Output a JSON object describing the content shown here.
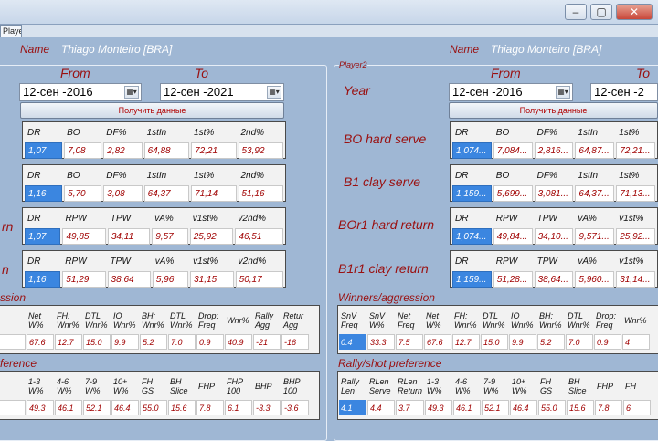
{
  "window": {
    "tab_label": "Player2",
    "controls": {
      "minimize": "–",
      "maximize": "▢",
      "close": "✕"
    }
  },
  "left": {
    "name_label": "Name",
    "name_value": "Thiago Monteiro [BRA]",
    "from_label": "From",
    "to_label": "To",
    "from_date": "12-сен -2016",
    "to_date": "12-сен -2021",
    "get_data_button": "Получить данные",
    "row_labels": [
      "",
      "",
      "rn",
      "n"
    ],
    "serve_headers": [
      "DR",
      "BO",
      "DF%",
      "1stIn",
      "1st%",
      "2nd%"
    ],
    "return_headers": [
      "DR",
      "RPW",
      "TPW",
      "vA%",
      "v1st%",
      "v2nd%"
    ],
    "box1": [
      "1,07",
      "7,08",
      "2,82",
      "64,88",
      "72,21",
      "53,92"
    ],
    "box2": [
      "1,16",
      "5,70",
      "3,08",
      "64,37",
      "71,14",
      "51,16"
    ],
    "box3": [
      "1,07",
      "49,85",
      "34,11",
      "9,57",
      "25,92",
      "46,51"
    ],
    "box4": [
      "1,16",
      "51,29",
      "38,64",
      "5,96",
      "31,15",
      "50,17"
    ],
    "winners_label": "ssion",
    "winners_headers": [
      "",
      "Net\nW%",
      "FH:\nWnr%",
      "DTL\nWnr%",
      "IO\nWnr%",
      "BH:\nWnr%",
      "DTL\nWnr%",
      "Drop:\nFreq",
      "Wnr%",
      "Rally\nAgg",
      "Retur\nAgg"
    ],
    "winners_values": [
      "",
      "67.6",
      "12.7",
      "15.0",
      "9.9",
      "5.2",
      "7.0",
      "0.9",
      "40.9",
      "-21",
      "-16"
    ],
    "rally_label": "ference",
    "rally_headers": [
      "",
      "1-3\nW%",
      "4-6\nW%",
      "7-9\nW%",
      "10+\nW%",
      "FH\nGS",
      "BH\nSlice",
      "FHP",
      "FHP\n100",
      "BHP",
      "BHP\n100"
    ],
    "rally_values": [
      "",
      "49.3",
      "46.1",
      "52.1",
      "46.4",
      "55.0",
      "15.6",
      "7.8",
      "6.1",
      "-3.3",
      "-3.6"
    ]
  },
  "right": {
    "group_label": "Player2",
    "name_label": "Name",
    "name_value": "Thiago Monteiro [BRA]",
    "from_label": "From",
    "to_label": "To",
    "year_label": "Year",
    "from_date": "12-сен -2016",
    "to_date": "12-сен -2",
    "get_data_button": "Получить данные",
    "row_labels": [
      "BO hard serve",
      "B1 clay serve",
      "BOr1 hard return",
      "B1r1 clay return"
    ],
    "serve_headers": [
      "DR",
      "BO",
      "DF%",
      "1stIn",
      "1st%"
    ],
    "return_headers": [
      "DR",
      "RPW",
      "TPW",
      "vA%",
      "v1st%"
    ],
    "box1": [
      "1,074...",
      "7,084...",
      "2,816...",
      "64,87...",
      "72,21..."
    ],
    "box2": [
      "1,159...",
      "5,699...",
      "3,081...",
      "64,37...",
      "71,13..."
    ],
    "box3": [
      "1,074...",
      "49,84...",
      "34,10...",
      "9,571...",
      "25,92..."
    ],
    "box4": [
      "1,159...",
      "51,28...",
      "38,64...",
      "5,960...",
      "31,14..."
    ],
    "winners_label": "Winners/aggression",
    "winners_headers": [
      "SnV\nFreq",
      "SnV\nW%",
      "Net\nFreq",
      "Net\nW%",
      "FH:\nWnr%",
      "DTL\nWnr%",
      "IO\nWnr%",
      "BH:\nWnr%",
      "DTL\nWnr%",
      "Drop:\nFreq",
      "Wnr%"
    ],
    "winners_values": [
      "0.4",
      "33.3",
      "7.5",
      "67.6",
      "12.7",
      "15.0",
      "9.9",
      "5.2",
      "7.0",
      "0.9",
      "4"
    ],
    "rally_label": "Rally/shot preference",
    "rally_headers": [
      "Rally\nLen",
      "RLen\nServe",
      "RLen\nReturn",
      "1-3\nW%",
      "4-6\nW%",
      "7-9\nW%",
      "10+\nW%",
      "FH\nGS",
      "BH\nSlice",
      "FHP",
      "FH"
    ],
    "rally_values": [
      "4.1",
      "4.4",
      "3.7",
      "49.3",
      "46.1",
      "52.1",
      "46.4",
      "55.0",
      "15.6",
      "7.8",
      "6"
    ]
  }
}
